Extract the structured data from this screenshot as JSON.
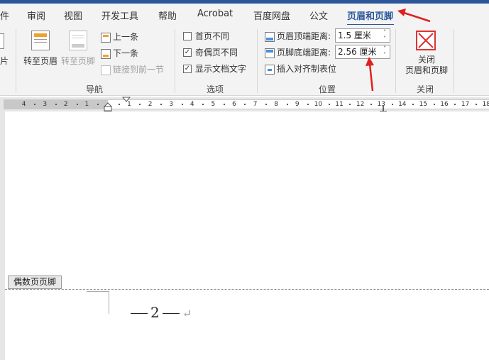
{
  "tabs": [
    {
      "label": "件"
    },
    {
      "label": "审阅"
    },
    {
      "label": "视图"
    },
    {
      "label": "开发工具"
    },
    {
      "label": "帮助"
    },
    {
      "label": "Acrobat"
    },
    {
      "label": "百度网盘"
    },
    {
      "label": "公文"
    },
    {
      "label": "页眉和页脚"
    }
  ],
  "nav": {
    "partial_label": "片",
    "goto_header": "转至页眉",
    "goto_footer": "转至页脚",
    "prev": "上一条",
    "next": "下一条",
    "link_prev": "链接到前一节",
    "group_title": "导航"
  },
  "options": {
    "different_first": "首页不同",
    "different_odd_even": "奇偶页不同",
    "show_doc_text": "显示文档文字",
    "different_first_checked": false,
    "different_odd_even_checked": true,
    "show_doc_text_checked": true,
    "group_title": "选项"
  },
  "position": {
    "header_from_top_label": "页眉顶端距离:",
    "header_from_top_value": "1.5 厘米",
    "footer_from_bottom_label": "页脚底端距离:",
    "footer_from_bottom_value": "2.56 厘米",
    "insert_align_tab": "插入对齐制表位",
    "group_title": "位置"
  },
  "close": {
    "line1": "关闭",
    "line2": "页眉和页脚",
    "group_title": "关闭"
  },
  "ruler": {
    "left_numbers": [
      "4",
      "3",
      "2",
      "1"
    ],
    "right_numbers": [
      "1",
      "2",
      "3",
      "4",
      "5",
      "6",
      "7",
      "8",
      "9",
      "10",
      "11",
      "12",
      "13",
      "14",
      "15",
      "16",
      "17",
      "18"
    ]
  },
  "document": {
    "footer_tag": "偶数页页脚",
    "page_number": "2",
    "paragraph_mark": "↵"
  },
  "colors": {
    "accent": "#2b579a",
    "arrow": "#e02020"
  }
}
